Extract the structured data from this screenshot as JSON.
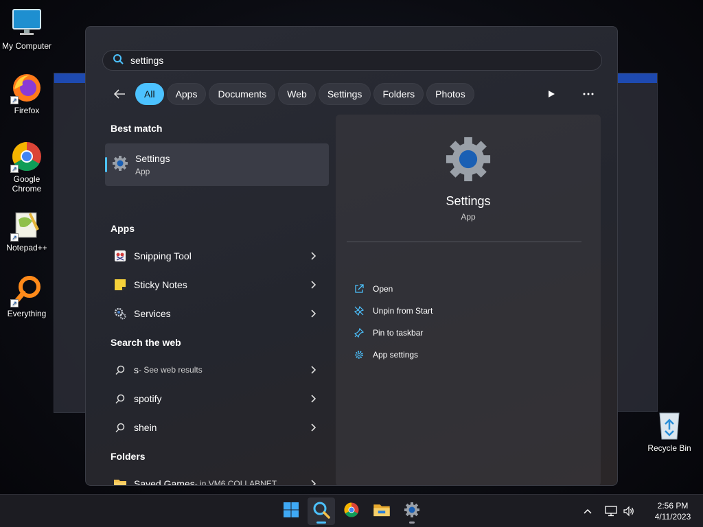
{
  "desktop": {
    "icons": [
      {
        "label": "My Computer"
      },
      {
        "label": "Firefox"
      },
      {
        "label": "Google Chrome"
      },
      {
        "label": "Notepad++"
      },
      {
        "label": "Everything"
      }
    ],
    "recycle_bin": "Recycle Bin"
  },
  "search": {
    "query": "settings",
    "filters": [
      "All",
      "Apps",
      "Documents",
      "Web",
      "Settings",
      "Folders",
      "Photos"
    ],
    "active_filter": "All"
  },
  "results": {
    "best_match_title": "Best match",
    "best_match": {
      "name": "Settings",
      "type": "App"
    },
    "apps_title": "Apps",
    "apps": [
      "Snipping Tool",
      "Sticky Notes",
      "Services"
    ],
    "web_title": "Search the web",
    "web": [
      {
        "term": "s",
        "suffix": " - See web results"
      },
      {
        "term": "spotify",
        "suffix": ""
      },
      {
        "term": "shein",
        "suffix": ""
      }
    ],
    "folders_title": "Folders",
    "folders": [
      {
        "name": "Saved Games",
        "suffix": " - in VM6.COLLABNET"
      }
    ]
  },
  "detail": {
    "name": "Settings",
    "type": "App",
    "actions": [
      "Open",
      "Unpin from Start",
      "Pin to taskbar",
      "App settings"
    ]
  },
  "taskbar": {
    "time": "2:56 PM",
    "date": "4/11/2023"
  },
  "colors": {
    "accent": "#4cc2ff",
    "panel": "#2a2c35"
  }
}
